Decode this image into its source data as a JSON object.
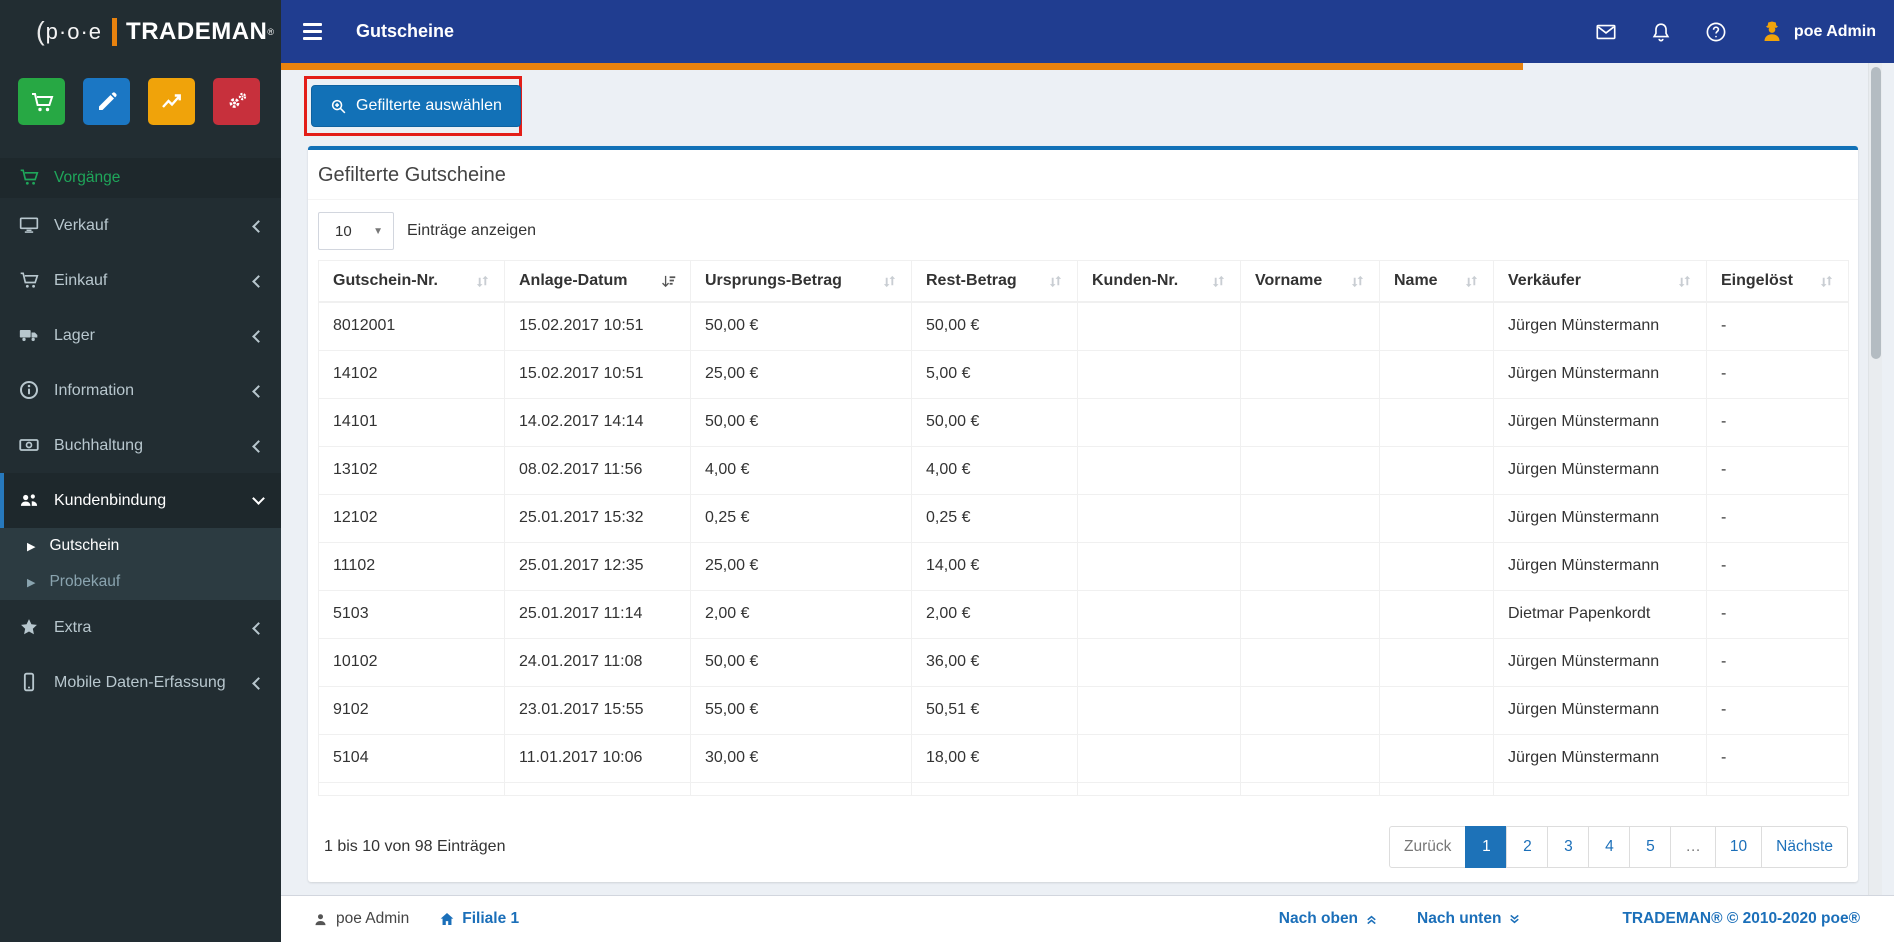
{
  "brand": {
    "prefix": "p·o·e",
    "name": "TRADEMAN",
    "reg": "®"
  },
  "navbar": {
    "title": "Gutscheine",
    "username": "poe Admin"
  },
  "sidebar": {
    "items": [
      {
        "label": "Vorgänge"
      },
      {
        "label": "Verkauf"
      },
      {
        "label": "Einkauf"
      },
      {
        "label": "Lager"
      },
      {
        "label": "Information"
      },
      {
        "label": "Buchhaltung"
      },
      {
        "label": "Kundenbindung"
      },
      {
        "label": "Gutschein"
      },
      {
        "label": "Probekauf"
      },
      {
        "label": "Extra"
      },
      {
        "label": "Mobile Daten-Erfassung"
      }
    ]
  },
  "toolbar": {
    "filter_button_label": "Gefilterte auswählen"
  },
  "panel": {
    "title": "Gefilterte Gutscheine",
    "entries_select": {
      "value": "10",
      "label": "Einträge anzeigen"
    },
    "table": {
      "columns": [
        "Gutschein-Nr.",
        "Anlage-Datum",
        "Ursprungs-Betrag",
        "Rest-Betrag",
        "Kunden-Nr.",
        "Vorname",
        "Name",
        "Verkäufer",
        "Eingelöst"
      ],
      "sorted_column": "Anlage-Datum",
      "sort_direction": "desc",
      "rows": [
        [
          "8012001",
          "15.02.2017 10:51",
          "50,00 €",
          "50,00 €",
          "",
          "",
          "",
          "Jürgen Münstermann",
          "-"
        ],
        [
          "14102",
          "15.02.2017 10:51",
          "25,00 €",
          "5,00 €",
          "",
          "",
          "",
          "Jürgen Münstermann",
          "-"
        ],
        [
          "14101",
          "14.02.2017 14:14",
          "50,00 €",
          "50,00 €",
          "",
          "",
          "",
          "Jürgen Münstermann",
          "-"
        ],
        [
          "13102",
          "08.02.2017 11:56",
          "4,00 €",
          "4,00 €",
          "",
          "",
          "",
          "Jürgen Münstermann",
          "-"
        ],
        [
          "12102",
          "25.01.2017 15:32",
          "0,25 €",
          "0,25 €",
          "",
          "",
          "",
          "Jürgen Münstermann",
          "-"
        ],
        [
          "11102",
          "25.01.2017 12:35",
          "25,00 €",
          "14,00 €",
          "",
          "",
          "",
          "Jürgen Münstermann",
          "-"
        ],
        [
          "5103",
          "25.01.2017 11:14",
          "2,00 €",
          "2,00 €",
          "",
          "",
          "",
          "Dietmar Papenkordt",
          "-"
        ],
        [
          "10102",
          "24.01.2017 11:08",
          "50,00 €",
          "36,00 €",
          "",
          "",
          "",
          "Jürgen Münstermann",
          "-"
        ],
        [
          "9102",
          "23.01.2017 15:55",
          "55,00 €",
          "50,51 €",
          "",
          "",
          "",
          "Jürgen Münstermann",
          "-"
        ],
        [
          "5104",
          "11.01.2017 10:06",
          "30,00 €",
          "18,00 €",
          "",
          "",
          "",
          "Jürgen Münstermann",
          "-"
        ]
      ]
    },
    "info": "1 bis 10 von 98 Einträgen",
    "pagination": {
      "prev": "Zurück",
      "pages": [
        "1",
        "2",
        "3",
        "4",
        "5",
        "…",
        "10"
      ],
      "active_page": "1",
      "next": "Nächste"
    }
  },
  "footer": {
    "username": "poe Admin",
    "branch": "Filiale 1",
    "nach_oben": "Nach oben",
    "nach_unten": "Nach unten",
    "copyright": "TRADEMAN® © 2010-2020 poe®"
  },
  "colors": {
    "navbar_blue": "#203d90",
    "accent_orange": "#e8820e",
    "primary_blue": "#1271b7",
    "sidebar_bg": "#222d32",
    "content_bg": "#ecf0f5",
    "annotation_red": "#e31e18",
    "active_green": "#1fa65a"
  }
}
